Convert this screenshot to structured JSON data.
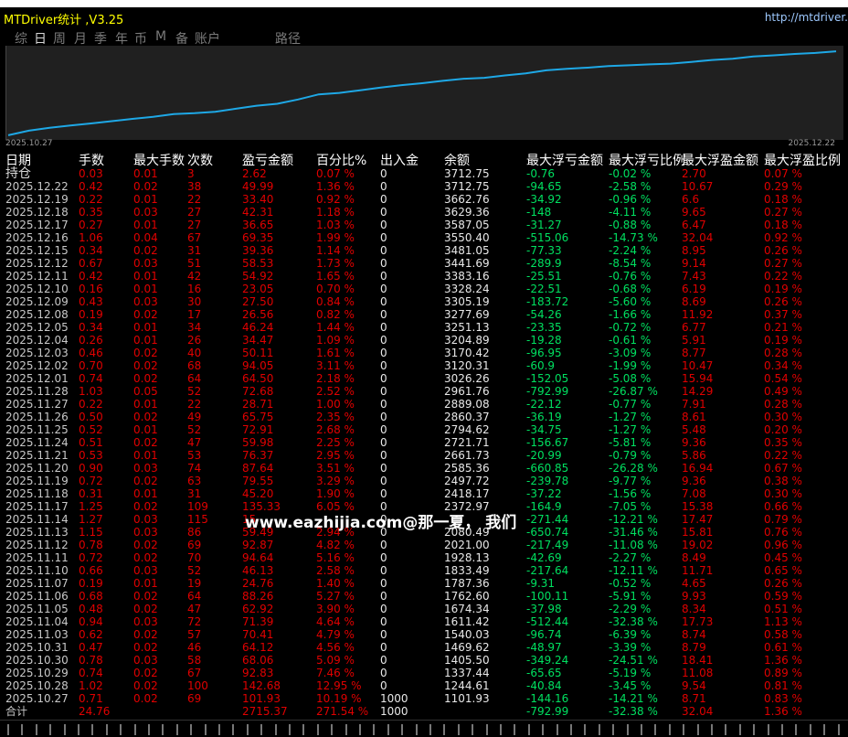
{
  "window": {
    "title": "MTDriver统计 ,V3.25",
    "url": "http://mtdriver."
  },
  "tabs": [
    {
      "label": "综",
      "active": false
    },
    {
      "label": "日",
      "active": true
    },
    {
      "label": "周",
      "active": false
    },
    {
      "label": "月",
      "active": false
    },
    {
      "label": "季",
      "active": false
    },
    {
      "label": "年",
      "active": false
    },
    {
      "label": "币",
      "active": false
    },
    {
      "label": "M",
      "active": false
    },
    {
      "label": "备",
      "active": false
    },
    {
      "label": "账户",
      "active": false
    },
    {
      "label": "路径",
      "active": false
    }
  ],
  "chart": {
    "start_label": "2025.10.27",
    "end_label": "2025.12.22",
    "line_color": "#1ea8e6"
  },
  "chart_data": {
    "type": "line",
    "x": [
      "2025.10.27",
      "2025.10.28",
      "2025.10.29",
      "2025.10.30",
      "2025.10.31",
      "2025.11.03",
      "2025.11.04",
      "2025.11.05",
      "2025.11.06",
      "2025.11.07",
      "2025.11.10",
      "2025.11.11",
      "2025.11.12",
      "2025.11.13",
      "2025.11.14",
      "2025.11.17",
      "2025.11.18",
      "2025.11.19",
      "2025.11.20",
      "2025.11.21",
      "2025.11.24",
      "2025.11.25",
      "2025.11.26",
      "2025.11.27",
      "2025.11.28",
      "2025.12.01",
      "2025.12.02",
      "2025.12.03",
      "2025.12.04",
      "2025.12.05",
      "2025.12.08",
      "2025.12.09",
      "2025.12.10",
      "2025.12.11",
      "2025.12.12",
      "2025.12.15",
      "2025.12.16",
      "2025.12.17",
      "2025.12.18",
      "2025.12.19",
      "2025.12.22"
    ],
    "series": [
      {
        "values": [
          1101.93,
          1244.61,
          1337.44,
          1405.5,
          1469.62,
          1540.03,
          1611.42,
          1674.34,
          1762.6,
          1787.36,
          1833.49,
          1928.13,
          2021.0,
          2080.49,
          2215.69,
          2372.97,
          2418.17,
          2497.72,
          2585.36,
          2661.73,
          2721.71,
          2794.62,
          2860.37,
          2889.08,
          2961.76,
          3026.26,
          3120.31,
          3170.42,
          3204.89,
          3251.13,
          3277.69,
          3305.19,
          3328.24,
          3383.16,
          3441.69,
          3481.05,
          3550.4,
          3587.05,
          3629.36,
          3662.76,
          3712.75
        ]
      }
    ]
  },
  "columns": [
    "日期",
    "手数",
    "最大手数",
    "次数",
    "盈亏金额",
    "百分比%",
    "出入金",
    "余额",
    "最大浮亏金额",
    "最大浮亏比例",
    "最大浮盈金额",
    "最大浮盈比例"
  ],
  "rows": [
    [
      "持仓",
      "0.03",
      "0.01",
      "3",
      "2.62",
      "0.07 %",
      "0",
      "3712.75",
      "-0.76",
      "-0.02 %",
      "2.70",
      "0.07 %"
    ],
    [
      "2025.12.22",
      "0.42",
      "0.02",
      "38",
      "49.99",
      "1.36 %",
      "0",
      "3712.75",
      "-94.65",
      "-2.58 %",
      "10.67",
      "0.29 %"
    ],
    [
      "2025.12.19",
      "0.22",
      "0.01",
      "22",
      "33.40",
      "0.92 %",
      "0",
      "3662.76",
      "-34.92",
      "-0.96 %",
      "6.6",
      "0.18 %"
    ],
    [
      "2025.12.18",
      "0.35",
      "0.03",
      "27",
      "42.31",
      "1.18 %",
      "0",
      "3629.36",
      "-148",
      "-4.11 %",
      "9.65",
      "0.27 %"
    ],
    [
      "2025.12.17",
      "0.27",
      "0.01",
      "27",
      "36.65",
      "1.03 %",
      "0",
      "3587.05",
      "-31.27",
      "-0.88 %",
      "6.47",
      "0.18 %"
    ],
    [
      "2025.12.16",
      "1.06",
      "0.04",
      "67",
      "69.35",
      "1.99 %",
      "0",
      "3550.40",
      "-515.06",
      "-14.73 %",
      "32.04",
      "0.92 %"
    ],
    [
      "2025.12.15",
      "0.34",
      "0.02",
      "31",
      "39.36",
      "1.14 %",
      "0",
      "3481.05",
      "-77.33",
      "-2.24 %",
      "8.95",
      "0.26 %"
    ],
    [
      "2025.12.12",
      "0.67",
      "0.03",
      "51",
      "58.53",
      "1.73 %",
      "0",
      "3441.69",
      "-289.9",
      "-8.54 %",
      "9.14",
      "0.27 %"
    ],
    [
      "2025.12.11",
      "0.42",
      "0.01",
      "42",
      "54.92",
      "1.65 %",
      "0",
      "3383.16",
      "-25.51",
      "-0.76 %",
      "7.43",
      "0.22 %"
    ],
    [
      "2025.12.10",
      "0.16",
      "0.01",
      "16",
      "23.05",
      "0.70 %",
      "0",
      "3328.24",
      "-22.51",
      "-0.68 %",
      "6.19",
      "0.19 %"
    ],
    [
      "2025.12.09",
      "0.43",
      "0.03",
      "30",
      "27.50",
      "0.84 %",
      "0",
      "3305.19",
      "-183.72",
      "-5.60 %",
      "8.69",
      "0.26 %"
    ],
    [
      "2025.12.08",
      "0.19",
      "0.02",
      "17",
      "26.56",
      "0.82 %",
      "0",
      "3277.69",
      "-54.26",
      "-1.66 %",
      "11.92",
      "0.37 %"
    ],
    [
      "2025.12.05",
      "0.34",
      "0.01",
      "34",
      "46.24",
      "1.44 %",
      "0",
      "3251.13",
      "-23.35",
      "-0.72 %",
      "6.77",
      "0.21 %"
    ],
    [
      "2025.12.04",
      "0.26",
      "0.01",
      "26",
      "34.47",
      "1.09 %",
      "0",
      "3204.89",
      "-19.28",
      "-0.61 %",
      "5.91",
      "0.19 %"
    ],
    [
      "2025.12.03",
      "0.46",
      "0.02",
      "40",
      "50.11",
      "1.61 %",
      "0",
      "3170.42",
      "-96.95",
      "-3.09 %",
      "8.77",
      "0.28 %"
    ],
    [
      "2025.12.02",
      "0.70",
      "0.02",
      "68",
      "94.05",
      "3.11 %",
      "0",
      "3120.31",
      "-60.9",
      "-1.99 %",
      "10.47",
      "0.34 %"
    ],
    [
      "2025.12.01",
      "0.74",
      "0.02",
      "64",
      "64.50",
      "2.18 %",
      "0",
      "3026.26",
      "-152.05",
      "-5.08 %",
      "15.94",
      "0.54 %"
    ],
    [
      "2025.11.28",
      "1.03",
      "0.05",
      "52",
      "72.68",
      "2.52 %",
      "0",
      "2961.76",
      "-792.99",
      "-26.87 %",
      "14.29",
      "0.49 %"
    ],
    [
      "2025.11.27",
      "0.22",
      "0.01",
      "22",
      "28.71",
      "1.00 %",
      "0",
      "2889.08",
      "-22.12",
      "-0.77 %",
      "7.91",
      "0.28 %"
    ],
    [
      "2025.11.26",
      "0.50",
      "0.02",
      "49",
      "65.75",
      "2.35 %",
      "0",
      "2860.37",
      "-36.19",
      "-1.27 %",
      "8.61",
      "0.30 %"
    ],
    [
      "2025.11.25",
      "0.52",
      "0.01",
      "52",
      "72.91",
      "2.68 %",
      "0",
      "2794.62",
      "-34.75",
      "-1.27 %",
      "5.48",
      "0.20 %"
    ],
    [
      "2025.11.24",
      "0.51",
      "0.02",
      "47",
      "59.98",
      "2.25 %",
      "0",
      "2721.71",
      "-156.67",
      "-5.81 %",
      "9.36",
      "0.35 %"
    ],
    [
      "2025.11.21",
      "0.53",
      "0.01",
      "53",
      "76.37",
      "2.95 %",
      "0",
      "2661.73",
      "-20.99",
      "-0.79 %",
      "5.86",
      "0.22 %"
    ],
    [
      "2025.11.20",
      "0.90",
      "0.03",
      "74",
      "87.64",
      "3.51 %",
      "0",
      "2585.36",
      "-660.85",
      "-26.28 %",
      "16.94",
      "0.67 %"
    ],
    [
      "2025.11.19",
      "0.72",
      "0.02",
      "63",
      "79.55",
      "3.29 %",
      "0",
      "2497.72",
      "-239.78",
      "-9.77 %",
      "9.36",
      "0.38 %"
    ],
    [
      "2025.11.18",
      "0.31",
      "0.01",
      "31",
      "45.20",
      "1.90 %",
      "0",
      "2418.17",
      "-37.22",
      "-1.56 %",
      "7.08",
      "0.30 %"
    ],
    [
      "2025.11.17",
      "1.25",
      "0.02",
      "109",
      "135.33",
      "6.05 %",
      "0",
      "2372.97",
      "-164.9",
      "-7.05 %",
      "15.38",
      "0.66 %"
    ],
    [
      "2025.11.14",
      "1.27",
      "0.03",
      "115",
      "15",
      "",
      "0",
      "",
      "-271.44",
      "-12.21 %",
      "17.47",
      "0.79 %"
    ],
    [
      "2025.11.13",
      "1.15",
      "0.03",
      "86",
      "59.49",
      "2.94 %",
      "0",
      "2080.49",
      "-650.74",
      "-31.46 %",
      "15.81",
      "0.76 %"
    ],
    [
      "2025.11.12",
      "0.78",
      "0.02",
      "69",
      "92.87",
      "4.82 %",
      "0",
      "2021.00",
      "-217.49",
      "-11.08 %",
      "19.02",
      "0.96 %"
    ],
    [
      "2025.11.11",
      "0.72",
      "0.02",
      "70",
      "94.64",
      "5.16 %",
      "0",
      "1928.13",
      "-42.69",
      "-2.27 %",
      "8.49",
      "0.45 %"
    ],
    [
      "2025.11.10",
      "0.66",
      "0.03",
      "52",
      "46.13",
      "2.58 %",
      "0",
      "1833.49",
      "-217.64",
      "-12.11 %",
      "11.71",
      "0.65 %"
    ],
    [
      "2025.11.07",
      "0.19",
      "0.01",
      "19",
      "24.76",
      "1.40 %",
      "0",
      "1787.36",
      "-9.31",
      "-0.52 %",
      "4.65",
      "0.26 %"
    ],
    [
      "2025.11.06",
      "0.68",
      "0.02",
      "64",
      "88.26",
      "5.27 %",
      "0",
      "1762.60",
      "-100.11",
      "-5.91 %",
      "9.93",
      "0.59 %"
    ],
    [
      "2025.11.05",
      "0.48",
      "0.02",
      "47",
      "62.92",
      "3.90 %",
      "0",
      "1674.34",
      "-37.98",
      "-2.29 %",
      "8.34",
      "0.51 %"
    ],
    [
      "2025.11.04",
      "0.94",
      "0.03",
      "72",
      "71.39",
      "4.64 %",
      "0",
      "1611.42",
      "-512.44",
      "-32.38 %",
      "17.73",
      "1.13 %"
    ],
    [
      "2025.11.03",
      "0.62",
      "0.02",
      "57",
      "70.41",
      "4.79 %",
      "0",
      "1540.03",
      "-96.74",
      "-6.39 %",
      "8.74",
      "0.58 %"
    ],
    [
      "2025.10.31",
      "0.47",
      "0.02",
      "46",
      "64.12",
      "4.56 %",
      "0",
      "1469.62",
      "-48.97",
      "-3.39 %",
      "8.79",
      "0.61 %"
    ],
    [
      "2025.10.30",
      "0.78",
      "0.03",
      "58",
      "68.06",
      "5.09 %",
      "0",
      "1405.50",
      "-349.24",
      "-24.51 %",
      "18.41",
      "1.36 %"
    ],
    [
      "2025.10.29",
      "0.74",
      "0.02",
      "67",
      "92.83",
      "7.46 %",
      "0",
      "1337.44",
      "-65.65",
      "-5.19 %",
      "11.08",
      "0.89 %"
    ],
    [
      "2025.10.28",
      "1.02",
      "0.02",
      "100",
      "142.68",
      "12.95 %",
      "0",
      "1244.61",
      "-40.84",
      "-3.45 %",
      "9.54",
      "0.81 %"
    ],
    [
      "2025.10.27",
      "0.71",
      "0.02",
      "69",
      "101.93",
      "10.19 %",
      "1000",
      "1101.93",
      "-144.16",
      "-14.21 %",
      "8.71",
      "0.83 %"
    ]
  ],
  "total": [
    "合计",
    "24.76",
    "",
    "",
    "2715.37",
    "271.54 %",
    "1000",
    "",
    "-792.99",
    "-32.38 %",
    "32.04",
    "1.36 %"
  ],
  "watermark": "www.eazhijia.com@那一夏， 我们"
}
